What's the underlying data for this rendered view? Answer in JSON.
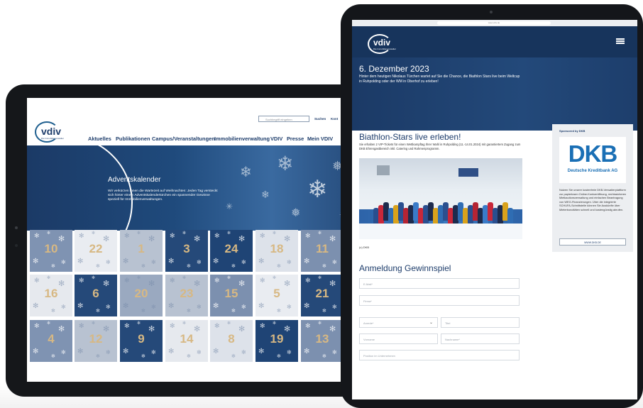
{
  "left_page": {
    "logo_text": "vdiv",
    "logo_subtitle": "Die Immobilienverwalter",
    "search_placeholder": "Suchbegriff eingeben",
    "search_button": "Suchen",
    "top_link": "Kont",
    "nav": [
      "Aktuelles",
      "Publikationen",
      "Campus/Veranstaltungen",
      "Immobilienverwaltung",
      "VDIV",
      "Presse",
      "Mein VDIV"
    ],
    "banner_title": "Adventskalender",
    "banner_text": "Wir verkürzen Ihnen die Wartezeit auf Weihnachten: Jeden Tag versteckt sich hinter einem Adventskalendertürchen ein spannender Gewinne speziell für Immobilienverwaltungen.",
    "doors": [
      "10",
      "22",
      "1",
      "3",
      "24",
      "18",
      "11",
      "16",
      "6",
      "20",
      "23",
      "15",
      "5",
      "21",
      "4",
      "12",
      "9",
      "14",
      "8",
      "19",
      "13"
    ]
  },
  "right_page": {
    "browser_address": "www.vdiv.de",
    "logo_text": "vdiv",
    "logo_subtitle": "Die Immobilienverwalter",
    "hero_date": "6. Dezember 2023",
    "hero_text": "Hinter dem heutigen Nikolaus Türchen wartet auf Sie die Chance, die Biathlon Stars live beim Weltcup in Ruhpolding oder der WM in Oberhof zu erleben!",
    "section_title": "Biathlon-Stars live erleben!",
    "section_text": "Sie erhalten 2 VIP-Tickets für einen Wettkampftag Ihrer Wahl in Ruhpolding (11.-14.01.2024) mit garantiertem Zugang zum DKB Ehrengastbereich inkl. Catering und Rahmenprogramm.",
    "photo_caption": "(c) DKB",
    "sponsor_label": "Sponsored by DKB",
    "sponsor_logo": "DKB",
    "sponsor_logo_sub": "Deutsche Kreditbank AG",
    "sponsor_text": "Nutzen Sie unsere kostenfreie DKB-Verwalterplattform zur papierlosen Online-Kontoeröffnung, rechtssicheren Mietkautionsverwaltung und einfachen Beantragung von WEG-Finanzierungen. Über die integrierte SCHUFA-Schnittstelle können Sie Auskünfte über Mieterbonoitäten schnell und kostengünstig abrufen.",
    "sponsor_button": "WWW.DKB.DE",
    "form_title": "Anmeldung Gewinnspiel",
    "fields": {
      "email": "E-Mail*",
      "firma": "Firma*",
      "anrede": "Anrede*",
      "titel": "Titel",
      "vorname": "Vorname",
      "nachname": "Nachname*",
      "position": "Position im Unternehmen"
    }
  },
  "colors": {
    "brand_navy": "#1e3d6b",
    "gold": "#d7b883",
    "dkb_blue": "#1a6fb5"
  }
}
